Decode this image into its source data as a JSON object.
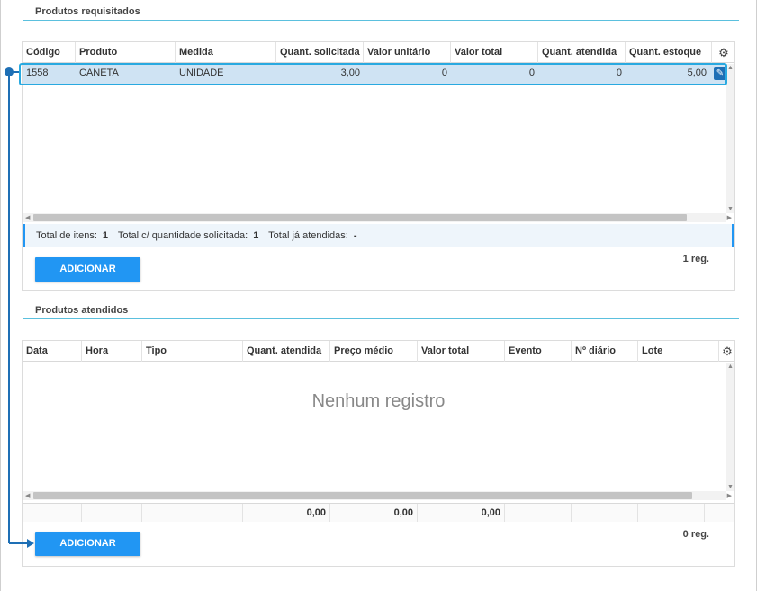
{
  "requested": {
    "title": "Produtos requisitados",
    "columns": [
      "Código",
      "Produto",
      "Medida",
      "Quant. solicitada",
      "Valor unitário",
      "Valor total",
      "Quant. atendida",
      "Quant. estoque"
    ],
    "rows": [
      [
        "1558",
        "CANETA",
        "UNIDADE",
        "3,00",
        "0",
        "0",
        "0",
        "5,00"
      ]
    ],
    "summary": {
      "items_label": "Total de itens:",
      "items_value": "1",
      "qty_label": "Total c/ quantidade solicitada:",
      "qty_value": "1",
      "served_label": "Total já atendidas:",
      "served_value": "-"
    },
    "add_label": "ADICIONAR",
    "reg": "1 reg."
  },
  "served": {
    "title": "Produtos atendidos",
    "columns": [
      "Data",
      "Hora",
      "Tipo",
      "Quant. atendida",
      "Preço médio",
      "Valor total",
      "Evento",
      "Nº diário",
      "Lote"
    ],
    "empty_text": "Nenhum registro",
    "totals": [
      "",
      "",
      "",
      "0,00",
      "0,00",
      "0,00",
      "",
      "",
      ""
    ],
    "add_label": "ADICIONAR",
    "reg": "0 reg."
  },
  "icons": {
    "settings": "gear-icon",
    "edit": "pencil-icon"
  },
  "colors": {
    "accent": "#2196f3",
    "highlight": "#29a9e0",
    "selected_row": "#cfe3f3",
    "connector": "#1e6fb5"
  }
}
